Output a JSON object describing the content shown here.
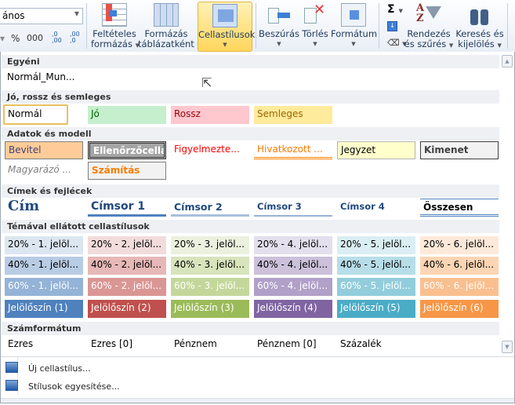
{
  "ribbon": {
    "number_format": "ános",
    "num_buttons": [
      "%",
      "000",
      ",0 ,00",
      ",00 ,0"
    ],
    "buttons": [
      {
        "label1": "Feltételes",
        "label2": "formázás",
        "name": "conditional-formatting"
      },
      {
        "label1": "Formázás",
        "label2": "táblázatként",
        "name": "format-as-table"
      },
      {
        "label1": "Cellastílusok",
        "label2": "",
        "name": "cell-styles"
      },
      {
        "label1": "Beszúrás",
        "label2": "",
        "name": "insert"
      },
      {
        "label1": "Törlés",
        "label2": "",
        "name": "delete"
      },
      {
        "label1": "Formátum",
        "label2": "",
        "name": "format"
      },
      {
        "label1": "Rendezés",
        "label2": "és szűrés",
        "name": "sort-filter"
      },
      {
        "label1": "Keresés és",
        "label2": "kijelölés",
        "name": "find-select"
      }
    ],
    "sigma": "Σ"
  },
  "gallery": {
    "custom": {
      "header": "Egyéni",
      "items": [
        "Normál_Mun..."
      ]
    },
    "good_bad": {
      "header": "Jó, rossz és semleges",
      "items": [
        "Normál",
        "Jó",
        "Rossz",
        "Semleges"
      ]
    },
    "data_model": {
      "header": "Adatok és modell",
      "items": [
        "Bevitel",
        "Ellenőrzőcella",
        "Figyelmezte...",
        "Hivatkozott ...",
        "Jegyzet",
        "Kimenet",
        "Magyarázó ...",
        "Számítás"
      ]
    },
    "titles": {
      "header": "Címek és fejlécek",
      "items": [
        "Cím",
        "Címsor 1",
        "Címsor 2",
        "Címsor 3",
        "Címsor 4",
        "Összesen"
      ]
    },
    "themed": {
      "header": "Témával ellátott cellastílusok",
      "rows": [
        [
          "20% - 1. jelöl...",
          "20% - 2. jelöl...",
          "20% - 3. jelöl...",
          "20% - 4. jelöl...",
          "20% - 5. jelöl...",
          "20% - 6. jelöl..."
        ],
        [
          "40% - 1. jelöl...",
          "40% - 2. jelöl...",
          "40% - 3. jelöl...",
          "40% - 4. jelöl...",
          "40% - 5. jelöl...",
          "40% - 6. jelöl..."
        ],
        [
          "60% - 1. jelöl...",
          "60% - 2. jelöl...",
          "60% - 3. jelöl...",
          "60% - 4. jelöl...",
          "60% - 5. jelöl...",
          "60% - 6. jelöl..."
        ],
        [
          "Jelölőszín (1)",
          "Jelölőszín (2)",
          "Jelölőszín (3)",
          "Jelölőszín (4)",
          "Jelölőszín (5)",
          "Jelölőszín (6)"
        ]
      ],
      "colors": [
        [
          "#dce6f1",
          "#f2dcdb",
          "#ebf1de",
          "#e4dfec",
          "#daeef3",
          "#fde9d9"
        ],
        [
          "#b8cce4",
          "#e6b8b7",
          "#d8e4bc",
          "#ccc0da",
          "#b7dee8",
          "#fcd5b4"
        ],
        [
          "#95b3d7",
          "#da9694",
          "#c4d79b",
          "#b1a0c7",
          "#92cddc",
          "#fabf8f"
        ],
        [
          "#4f81bd",
          "#c0504d",
          "#9bbb59",
          "#8064a2",
          "#4bacc6",
          "#f79646"
        ]
      ]
    },
    "number": {
      "header": "Számformátum",
      "items": [
        "Ezres",
        "Ezres [0]",
        "Pénznem",
        "Pénznem [0]",
        "Százalék"
      ]
    }
  },
  "menu": {
    "new_style": "Új cellastílus...",
    "merge_styles": "Stílusok egyesítése..."
  }
}
